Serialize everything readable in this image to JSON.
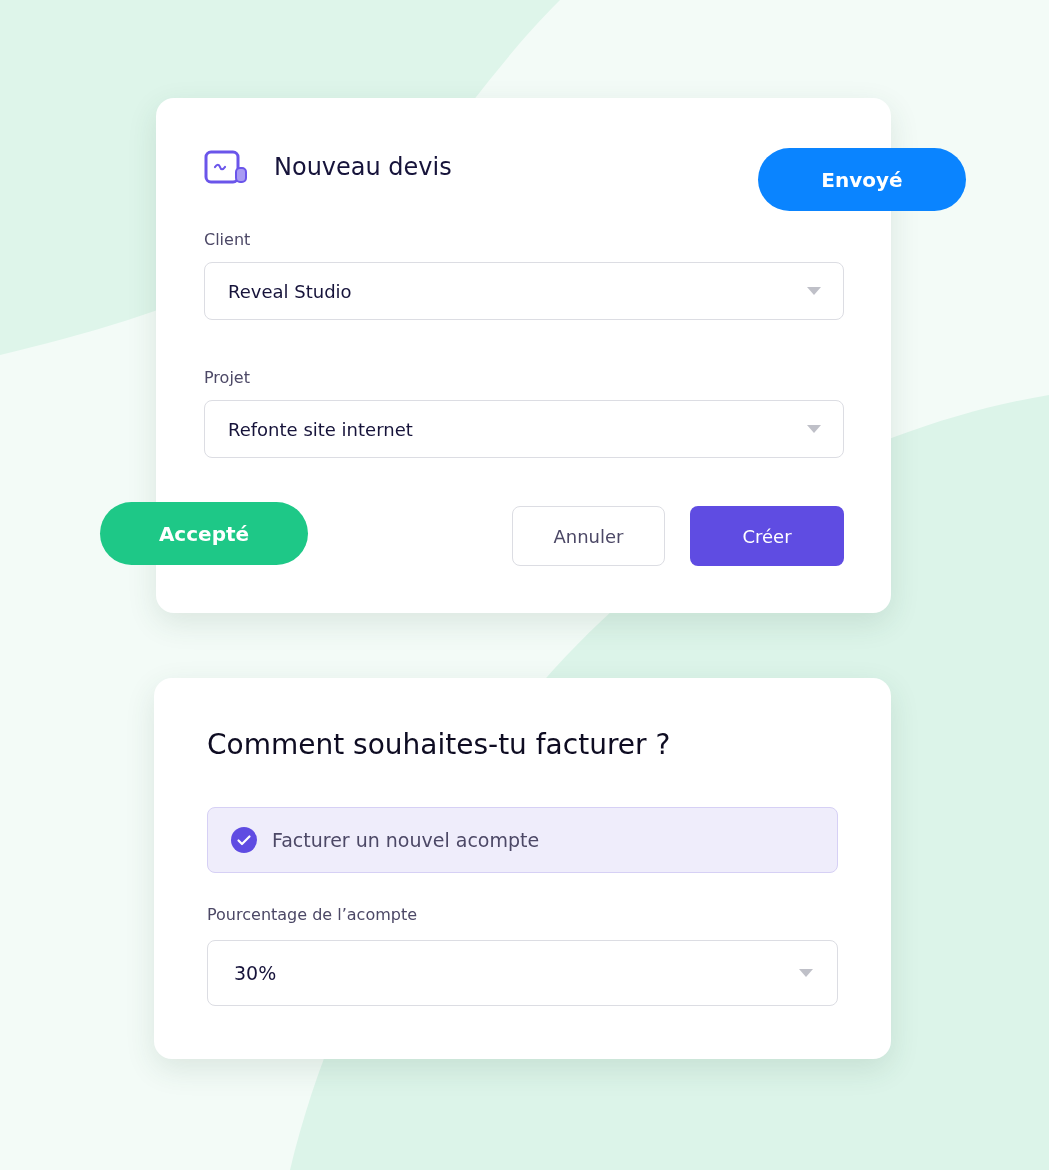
{
  "quote_card": {
    "title": "Nouveau devis",
    "fields": [
      {
        "label": "Client",
        "value": "Reveal Studio"
      },
      {
        "label": "Projet",
        "value": "Refonte site internet"
      }
    ],
    "buttons": [
      {
        "label": "Annuler",
        "kind": "secondary"
      },
      {
        "label": "Créer",
        "kind": "primary"
      }
    ]
  },
  "badges": [
    {
      "label": "Envoyé",
      "color": "#0a84ff"
    },
    {
      "label": "Accepté",
      "color": "#1ec887"
    }
  ],
  "billing_card": {
    "title": "Comment souhaites-tu facturer ?",
    "option": {
      "label": "Facturer un nouvel acompte",
      "checked": true
    },
    "field": {
      "label": "Pourcentage de l’acompte",
      "value": "30%"
    }
  }
}
